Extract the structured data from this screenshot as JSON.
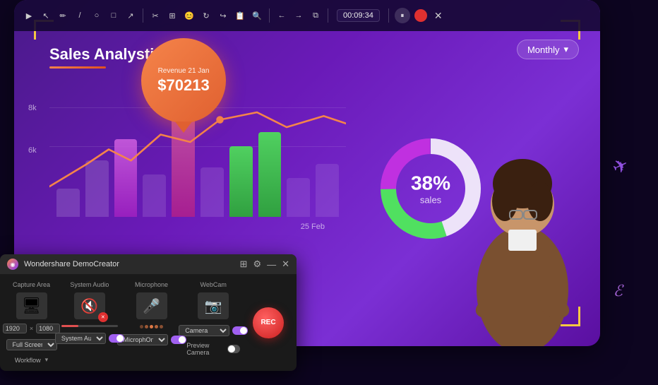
{
  "screen": {
    "bg_color": "#5a1ab8"
  },
  "toolbar": {
    "timer": "00:09:34",
    "buttons": [
      "▶",
      "✏",
      "◯",
      "□",
      "↗",
      "✂",
      "⊞",
      "😊",
      "↻",
      "↪",
      "📋",
      "🔍",
      "←",
      "→",
      "⧉"
    ]
  },
  "analytics": {
    "title": "Sales Analystics",
    "revenue_label": "Revenue 21 Jan",
    "revenue_amount": "$70213",
    "y_label_8k": "8k",
    "y_label_6k": "6k",
    "x_label_feb": "25 Feb"
  },
  "donut": {
    "percent": "38%",
    "sub_label": "sales",
    "monthly_label": "Monthly"
  },
  "demo_creator": {
    "title": "Wondershare DemoCreator",
    "sections": {
      "capture": {
        "label": "Capture Area",
        "res_w": "1920",
        "res_h": "1080",
        "mode": "Full Screen"
      },
      "audio": {
        "label": "System Audio",
        "select_label": "System Au..."
      },
      "mic": {
        "label": "Microphone",
        "select_label": "MicrophOn..."
      },
      "webcam": {
        "label": "WebCam",
        "select_label": "Camera",
        "preview_label": "Preview Camera"
      }
    },
    "rec_label": "REC",
    "workflow_label": "Workflow",
    "timer_btn": "⊞"
  }
}
